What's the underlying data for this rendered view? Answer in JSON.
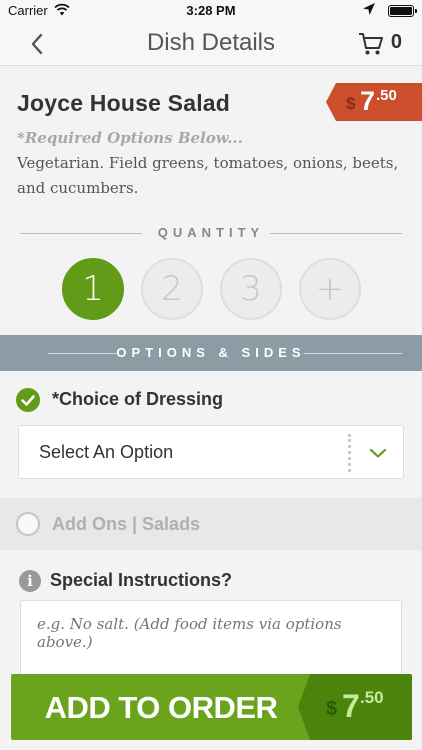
{
  "status_bar": {
    "carrier": "Carrier",
    "time": "3:28 PM"
  },
  "nav": {
    "title": "Dish Details",
    "cart_count": "0"
  },
  "dish": {
    "name": "Joyce House Salad",
    "price_currency": "$",
    "price_whole": "7",
    "price_cents": ".50",
    "required_note": "*Required Options Below...",
    "description": "Vegetarian. Field greens, tomatoes, onions, beets, and cucumbers."
  },
  "quantity": {
    "label": "QUANTITY",
    "options": [
      "1",
      "2",
      "3",
      "+"
    ],
    "selected": "1"
  },
  "options": {
    "header": "OPTIONS & SIDES",
    "dressing": {
      "label": "*Choice of Dressing",
      "value": "Select An Option"
    },
    "addons": {
      "label": "Add Ons | Salads"
    }
  },
  "instructions": {
    "label": "Special Instructions?",
    "placeholder": "e.g. No salt. (Add food items via options above.)"
  },
  "add_button": {
    "label": "ADD TO ORDER",
    "price_currency": "$",
    "price_whole": "7",
    "price_cents": ".50"
  },
  "colors": {
    "accent_green": "#629b17",
    "price_red": "#cc4f2d",
    "options_bar": "#8d9ba4"
  }
}
